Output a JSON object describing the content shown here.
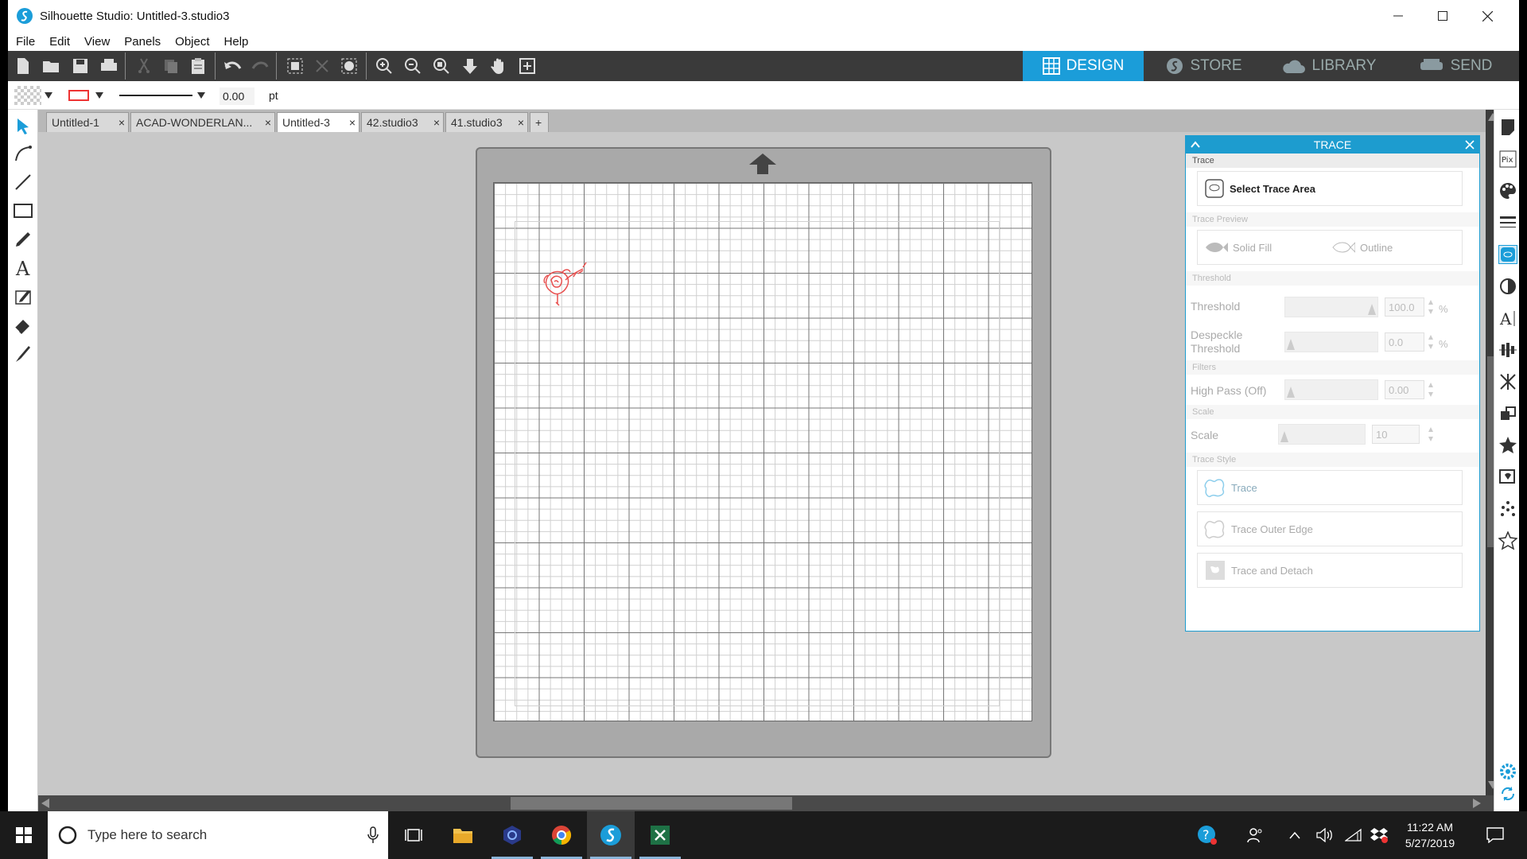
{
  "window": {
    "title": "Silhouette Studio: Untitled-3.studio3"
  },
  "menu": [
    "File",
    "Edit",
    "View",
    "Panels",
    "Object",
    "Help"
  ],
  "nav_tabs": [
    {
      "label": "DESIGN",
      "active": true
    },
    {
      "label": "STORE",
      "active": false
    },
    {
      "label": "LIBRARY",
      "active": false
    },
    {
      "label": "SEND",
      "active": false
    }
  ],
  "properties": {
    "line_width_value": "0.00",
    "line_width_unit": "pt"
  },
  "doc_tabs": [
    {
      "label": "Untitled-1",
      "active": false
    },
    {
      "label": "ACAD-WONDERLAN...",
      "active": false
    },
    {
      "label": "Untitled-3",
      "active": true
    },
    {
      "label": "42.studio3",
      "active": false
    },
    {
      "label": "41.studio3",
      "active": false
    }
  ],
  "add_tab_label": "+",
  "trace_panel": {
    "header": "TRACE",
    "sections": {
      "trace": "Trace",
      "preview": "Trace Preview",
      "threshold": "Threshold",
      "filters": "Filters",
      "scale": "Scale",
      "style": "Trace Style"
    },
    "select_area_label": "Select Trace Area",
    "solid_fill_label": "Solid Fill",
    "outline_label": "Outline",
    "threshold_label": "Threshold",
    "threshold_value": "100.0",
    "threshold_unit": "%",
    "despeckle_label_1": "Despeckle",
    "despeckle_label_2": "Threshold",
    "despeckle_value": "0.0",
    "despeckle_unit": "%",
    "highpass_label": "High Pass (Off)",
    "highpass_value": "0.00",
    "scale_label": "Scale",
    "scale_value": "10",
    "trace_btn": "Trace",
    "trace_outer_btn": "Trace Outer Edge",
    "trace_detach_btn": "Trace and Detach"
  },
  "taskbar": {
    "search_placeholder": "Type here to search",
    "time": "11:22 AM",
    "date": "5/27/2019"
  },
  "colors": {
    "accent": "#1b9dd9",
    "toolbar_bg": "#3a3a3a",
    "sketch": "#e8504f"
  }
}
